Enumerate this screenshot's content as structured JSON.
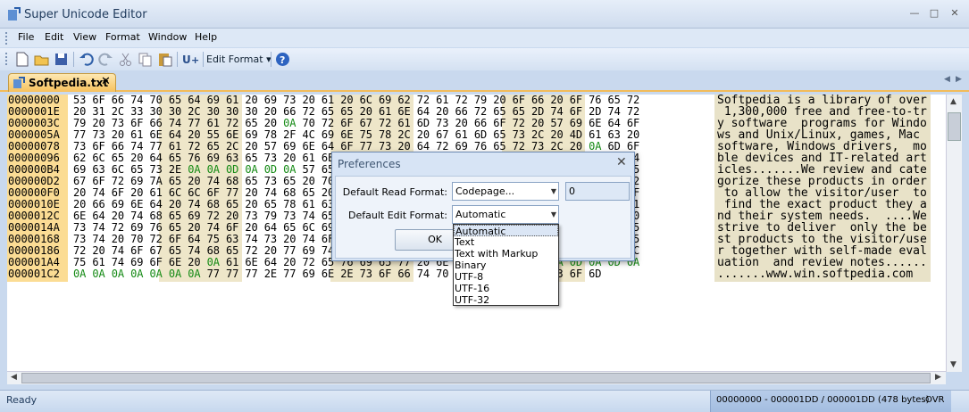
{
  "window": {
    "title": "Super Unicode Editor",
    "icons": {
      "minimize": "minimize-icon",
      "maximize": "maximize-icon",
      "close": "close-icon"
    }
  },
  "menu": [
    "File",
    "Edit",
    "View",
    "Format",
    "Window",
    "Help"
  ],
  "toolbar": {
    "edit_format_label": "Edit Format",
    "icons": [
      "new-icon",
      "open-icon",
      "save-icon",
      "undo-icon",
      "redo-icon",
      "cut-icon",
      "copy-icon",
      "paste-icon",
      "unicode-convert-icon",
      "help-icon"
    ]
  },
  "tab": {
    "label": "Softpedia.txt",
    "close": "✕"
  },
  "rows": [
    {
      "addr": "00000000",
      "hex": "53 6F 66 74 70 65 64 69 61 20 69 73 20 61 20 6C 69 62 72 61 72 79 20 6F 66 20 6F 76 65 72",
      "text": "Softpedia is a library of over"
    },
    {
      "addr": "0000001E",
      "hex": "20 31 2C 33 30 30 2C 30 30 30 20 66 72 65 65 20 61 6E 64 20 66 72 65 65 2D 74 6F 2D 74 72",
      "text": " 1,300,000 free and free-to-tr"
    },
    {
      "addr": "0000003C",
      "hex": "79 20 73 6F 66 74 77 61 72 65 20 0A 70 72 6F 67 72 61 6D 73 20 66 6F 72 20 57 69 6E 64 6F",
      "text": "y software  programs for Windo"
    },
    {
      "addr": "0000005A",
      "hex": "77 73 20 61 6E 64 20 55 6E 69 78 2F 4C 69 6E 75 78 2C 20 67 61 6D 65 73 2C 20 4D 61 63 20",
      "text": "ws and Unix/Linux, games, Mac "
    },
    {
      "addr": "00000078",
      "hex": "73 6F 66 74 77 61 72 65 2C 20 57 69 6E 64 6F 77 73 20 64 72 69 76 65 72 73 2C 20 0A 6D 6F",
      "text": "software, Windows drivers,  mo"
    },
    {
      "addr": "00000096",
      "hex": "62 6C 65 20 64 65 76 69 63 65 73 20 61 6E 64 20 49 54 2D 72 65 6C 61 74 65 64 20 61 72 74",
      "text": "ble devices and IT-related art"
    },
    {
      "addr": "000000B4",
      "hex": "69 63 6C 65 73 2E 0A 0A 0D 0A 0D 0A 57 65 20 72 65 76 69 65 77 20 61 6E 64 20 63 61 74 65",
      "text": "icles.......We review and cate"
    },
    {
      "addr": "000000D2",
      "hex": "67 6F 72 69 7A 65 20 74 68 65 73 65 20 70 72 6F 64 75 63 74 73 20 69 6E 20 6F 72 64 65 72",
      "text": "gorize these products in order"
    },
    {
      "addr": "000000F0",
      "hex": "20 74 6F 20 61 6C 6C 6F 77 20 74 68 65 20 76 69 73 69 74 6F 72 2F 75 73 65 72 20 0A 74 6F",
      "text": " to allow the visitor/user  to"
    },
    {
      "addr": "0000010E",
      "hex": "20 66 69 6E 64 20 74 68 65 20 65 78 61 63 74 20 70 72 6F 64 75 63 74 20 74 68 65 79 20 61",
      "text": " find the exact product they a"
    },
    {
      "addr": "0000012C",
      "hex": "6E 64 20 74 68 65 69 72 20 73 79 73 74 65 6D 20 6E 65 65 64 73 2E 20 0A 0A 0A 57 65 20 20",
      "text": "nd their system needs.  ....We"
    },
    {
      "addr": "0000014A",
      "hex": "73 74 72 69 76 65 20 74 6F 20 64 65 6C 69 76 65 72 20 0A 6F 6E 6C 79 20 74 68 65 20 62 65",
      "text": "strive to deliver  only the be"
    },
    {
      "addr": "00000168",
      "hex": "73 74 20 70 72 6F 64 75 63 74 73 20 74 6F 20 74 68 65 20 76 69 73 69 74 6F 72 2F 75 73 65",
      "text": "st products to the visitor/use"
    },
    {
      "addr": "00000186",
      "hex": "72 20 74 6F 67 65 74 68 65 72 20 77 69 74 68 20 73 65 6C 66 2D 6D 61 64 65 20 65 76 61 6C",
      "text": "r together with self-made eval"
    },
    {
      "addr": "000001A4",
      "hex": "75 61 74 69 6F 6E 20 0A 61 6E 64 20 72 65 76 69 65 77 20 6E 6F 74 65 73 2E 0A 0D 0A 0D 0A",
      "text": "uation  and review notes......"
    },
    {
      "addr": "000001C2",
      "hex": "0A 0A 0A 0A 0A 0A 0A 77 77 77 2E 77 69 6E 2E 73 6F 66 74 70 65 64 69 61 2E 63 6F 6D",
      "text": ".......www.win.softpedia.com"
    }
  ],
  "status": {
    "left": "Ready",
    "range": "00000000 - 000001DD / 000001DD (478 bytes)",
    "mode": "OVR"
  },
  "dialog": {
    "title": "Preferences",
    "read_label": "Default Read Format:",
    "read_value": "Codepage...",
    "codepage_value": "0",
    "edit_label": "Default Edit Format:",
    "edit_value": "Automatic",
    "ok_label": "OK",
    "options": [
      "Automatic",
      "Text",
      "Text with Markup",
      "Binary",
      "UTF-8",
      "UTF-16",
      "UTF-32"
    ]
  }
}
